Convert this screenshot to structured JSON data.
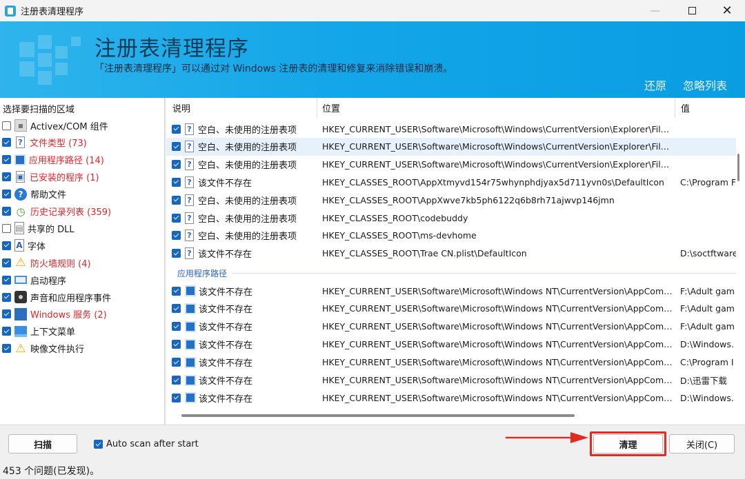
{
  "window": {
    "title": "注册表清理程序",
    "icon": "app-icon",
    "min_icon": "minimize-icon",
    "max_icon": "maximize-icon",
    "close_icon": "close-icon"
  },
  "banner": {
    "title": "注册表清理程序",
    "subtitle": "「注册表清理程序」可以通过对 Windows 注册表的清理和修复来消除错误和崩溃。",
    "restore_link": "还原",
    "ignore_list_link": "忽略列表"
  },
  "scan_areas": {
    "header": "选择要扫描的区域",
    "items": [
      {
        "label": "Activex/COM 组件",
        "checked": false,
        "icon": "com-icon",
        "red": false
      },
      {
        "label": "文件类型 (73)",
        "checked": true,
        "icon": "file-icon",
        "red": true
      },
      {
        "label": "应用程序路径 (14)",
        "checked": true,
        "icon": "application-icon",
        "red": true
      },
      {
        "label": "已安装的程序 (1)",
        "checked": true,
        "icon": "installer-icon",
        "red": true
      },
      {
        "label": "帮助文件",
        "checked": true,
        "icon": "help-icon",
        "red": false
      },
      {
        "label": "历史记录列表 (359)",
        "checked": true,
        "icon": "history-icon",
        "red": true
      },
      {
        "label": "共享的 DLL",
        "checked": false,
        "icon": "dll-icon",
        "red": false
      },
      {
        "label": "字体",
        "checked": true,
        "icon": "font-icon",
        "red": false
      },
      {
        "label": "防火墙规则 (4)",
        "checked": true,
        "icon": "warning-icon",
        "red": true
      },
      {
        "label": "启动程序",
        "checked": true,
        "icon": "startup-icon",
        "red": false
      },
      {
        "label": "声音和应用程序事件",
        "checked": true,
        "icon": "sound-icon",
        "red": false
      },
      {
        "label": "Windows 服务 (2)",
        "checked": true,
        "icon": "windows-icon",
        "red": true
      },
      {
        "label": "上下文菜单",
        "checked": true,
        "icon": "context-menu-icon",
        "red": false
      },
      {
        "label": "映像文件执行",
        "checked": true,
        "icon": "warning-icon",
        "red": false
      }
    ]
  },
  "results": {
    "columns": {
      "description": "说明",
      "location": "位置",
      "value": "值"
    },
    "rows_top": [
      {
        "description": "空白、未使用的注册表项",
        "location": "HKEY_CURRENT_USER\\Software\\Microsoft\\Windows\\CurrentVersion\\Explorer\\FileExts\\...",
        "value": "",
        "selected": false
      },
      {
        "description": "空白、未使用的注册表项",
        "location": "HKEY_CURRENT_USER\\Software\\Microsoft\\Windows\\CurrentVersion\\Explorer\\FileExts\\...",
        "value": "",
        "selected": true
      },
      {
        "description": "空白、未使用的注册表项",
        "location": "HKEY_CURRENT_USER\\Software\\Microsoft\\Windows\\CurrentVersion\\Explorer\\FileExts\\...",
        "value": "",
        "selected": false
      },
      {
        "description": "该文件不存在",
        "location": "HKEY_CLASSES_ROOT\\AppXtmyvd154r75whynphdjyax5d711yvn0s\\DefaultIcon",
        "value": "C:\\Program Fi",
        "selected": false
      },
      {
        "description": "空白、未使用的注册表项",
        "location": "HKEY_CLASSES_ROOT\\AppXwve7kb5ph6122q6b8rh71ajwvp146jmn",
        "value": "",
        "selected": false
      },
      {
        "description": "空白、未使用的注册表项",
        "location": "HKEY_CLASSES_ROOT\\codebuddy",
        "value": "",
        "selected": false
      },
      {
        "description": "空白、未使用的注册表项",
        "location": "HKEY_CLASSES_ROOT\\ms-devhome",
        "value": "",
        "selected": false
      },
      {
        "description": "该文件不存在",
        "location": "HKEY_CLASSES_ROOT\\Trae CN.plist\\DefaultIcon",
        "value": "D:\\soctftware",
        "selected": false
      }
    ],
    "group_label": "应用程序路径",
    "rows_bottom": [
      {
        "description": "该文件不存在",
        "location": "HKEY_CURRENT_USER\\Software\\Microsoft\\Windows NT\\CurrentVersion\\AppCompatF...",
        "value": "F:\\Adult gam"
      },
      {
        "description": "该文件不存在",
        "location": "HKEY_CURRENT_USER\\Software\\Microsoft\\Windows NT\\CurrentVersion\\AppCompatF...",
        "value": "F:\\Adult gam"
      },
      {
        "description": "该文件不存在",
        "location": "HKEY_CURRENT_USER\\Software\\Microsoft\\Windows NT\\CurrentVersion\\AppCompatF...",
        "value": "F:\\Adult gam"
      },
      {
        "description": "该文件不存在",
        "location": "HKEY_CURRENT_USER\\Software\\Microsoft\\Windows NT\\CurrentVersion\\AppCompatF...",
        "value": "D:\\Windows."
      },
      {
        "description": "该文件不存在",
        "location": "HKEY_CURRENT_USER\\Software\\Microsoft\\Windows NT\\CurrentVersion\\AppCompatF...",
        "value": "C:\\Program I"
      },
      {
        "description": "该文件不存在",
        "location": "HKEY_CURRENT_USER\\Software\\Microsoft\\Windows NT\\CurrentVersion\\AppCompatF...",
        "value": "D:\\迅雷下载"
      },
      {
        "description": "该文件不存在",
        "location": "HKEY_CURRENT_USER\\Software\\Microsoft\\Windows NT\\CurrentVersion\\AppCompatF...",
        "value": "D:\\Windows."
      }
    ]
  },
  "bottom": {
    "scan_button": "扫描",
    "auto_scan_label": "Auto scan after start",
    "auto_scan_checked": true,
    "clean_button": "清理",
    "close_button": "关闭(C)"
  },
  "status": {
    "text": "453  个问题(已发现)。"
  },
  "colors": {
    "accent": "#1766c1",
    "banner": "#13a6e8",
    "alert": "#e5252a",
    "highlight": "#e32b22"
  }
}
